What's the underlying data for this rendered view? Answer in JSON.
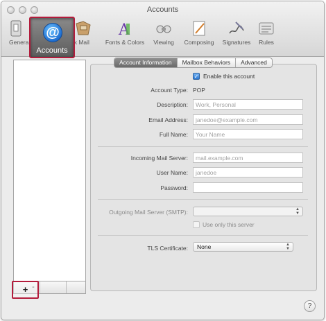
{
  "window": {
    "title": "Accounts"
  },
  "toolbar": {
    "items": [
      {
        "label": "General",
        "icon": "switch-icon"
      },
      {
        "label": "Accounts",
        "icon": "at-sign-icon"
      },
      {
        "label": "Junk Mail",
        "icon": "junk-mail-icon"
      },
      {
        "label": "Fonts & Colors",
        "icon": "fonts-colors-icon"
      },
      {
        "label": "Viewing",
        "icon": "viewing-icon"
      },
      {
        "label": "Composing",
        "icon": "composing-icon"
      },
      {
        "label": "Signatures",
        "icon": "signatures-icon"
      },
      {
        "label": "Rules",
        "icon": "rules-icon"
      }
    ],
    "general_visible": "Genera",
    "junk_visible": "nk Mail"
  },
  "tabs": [
    "Account Information",
    "Mailbox Behaviors",
    "Advanced"
  ],
  "form": {
    "enable_label": "Enable this account",
    "account_type_label": "Account Type:",
    "account_type_value": "POP",
    "description_label": "Description:",
    "description_placeholder": "Work, Personal",
    "email_label": "Email Address:",
    "email_placeholder": "janedoe@example.com",
    "fullname_label": "Full Name:",
    "fullname_placeholder": "Your Name",
    "incoming_label": "Incoming Mail Server:",
    "incoming_placeholder": "mail.example.com",
    "username_label": "User Name:",
    "username_placeholder": "janedoe",
    "password_label": "Password:",
    "smtp_label": "Outgoing Mail Server (SMTP):",
    "use_only_label": "Use only this server",
    "tls_label": "TLS Certificate:",
    "tls_value": "None"
  },
  "sidebar": {
    "add_button": "+",
    "remove_button": "-"
  },
  "help": {
    "label": "?"
  },
  "colors": {
    "highlight": "#b31c3c",
    "selected_tab": "#6a6a6a",
    "accounts_icon": "#1f6fd1"
  }
}
